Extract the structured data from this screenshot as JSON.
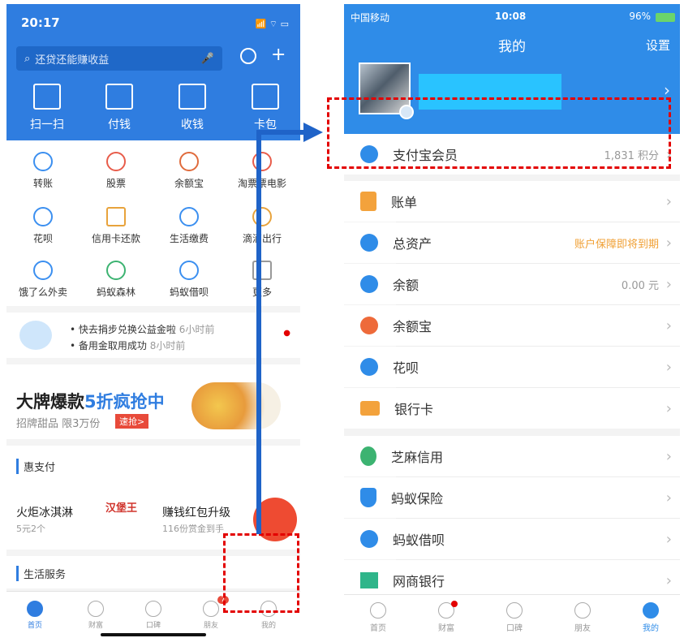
{
  "left": {
    "status_time": "20:17",
    "search_placeholder": "还贷还能赚收益",
    "quick_actions": [
      "扫一扫",
      "付钱",
      "收钱",
      "卡包"
    ],
    "grid": [
      "转账",
      "股票",
      "余额宝",
      "淘票票电影",
      "花呗",
      "信用卡还款",
      "生活缴费",
      "滴滴出行",
      "饿了么外卖",
      "蚂蚁森林",
      "蚂蚁借呗",
      "更多"
    ],
    "news": [
      {
        "text": "快去捐步兑换公益金啦",
        "time": "6小时前"
      },
      {
        "text": "备用金取用成功",
        "time": "8小时前"
      }
    ],
    "banner": {
      "title": "大牌爆款",
      "highlight": "5折疯抢中",
      "subtitle": "招牌甜品 限3万份",
      "button": "速抢>"
    },
    "hui_zhifu": "惠支付",
    "promo_1_title": "火炬冰淇淋",
    "promo_1_sub": "5元2个",
    "promo_brand": "汉堡王",
    "promo_2_title": "赚钱红包升级",
    "promo_2_sub": "116份赏金到手",
    "life_service": "生活服务",
    "tabs": [
      "首页",
      "财富",
      "口碑",
      "朋友",
      "我的"
    ],
    "friends_badge": "7"
  },
  "right": {
    "status": {
      "carrier": "中国移动",
      "time": "10:08",
      "battery": "96%"
    },
    "title": "我的",
    "settings": "设置",
    "items": [
      {
        "name": "member",
        "label": "支付宝会员",
        "value": "1,831 积分"
      },
      {
        "name": "bill",
        "label": "账单",
        "value": ""
      },
      {
        "name": "assets",
        "label": "总资产",
        "value": "账户保障即将到期"
      },
      {
        "name": "balance",
        "label": "余额",
        "value": "0.00 元"
      },
      {
        "name": "yuebao",
        "label": "余额宝",
        "value": ""
      },
      {
        "name": "huabei",
        "label": "花呗",
        "value": ""
      },
      {
        "name": "bankcard",
        "label": "银行卡",
        "value": ""
      },
      {
        "name": "zhima",
        "label": "芝麻信用",
        "value": ""
      },
      {
        "name": "insurance",
        "label": "蚂蚁保险",
        "value": ""
      },
      {
        "name": "jiebei",
        "label": "蚂蚁借呗",
        "value": ""
      },
      {
        "name": "mybank",
        "label": "网商银行",
        "value": ""
      }
    ],
    "tabs": [
      "首页",
      "财富",
      "口碑",
      "朋友",
      "我的"
    ]
  },
  "colors": {
    "brand_blue": "#2f8ce8",
    "annotation_red": "#e30000",
    "connector_blue": "#1f63c8"
  }
}
